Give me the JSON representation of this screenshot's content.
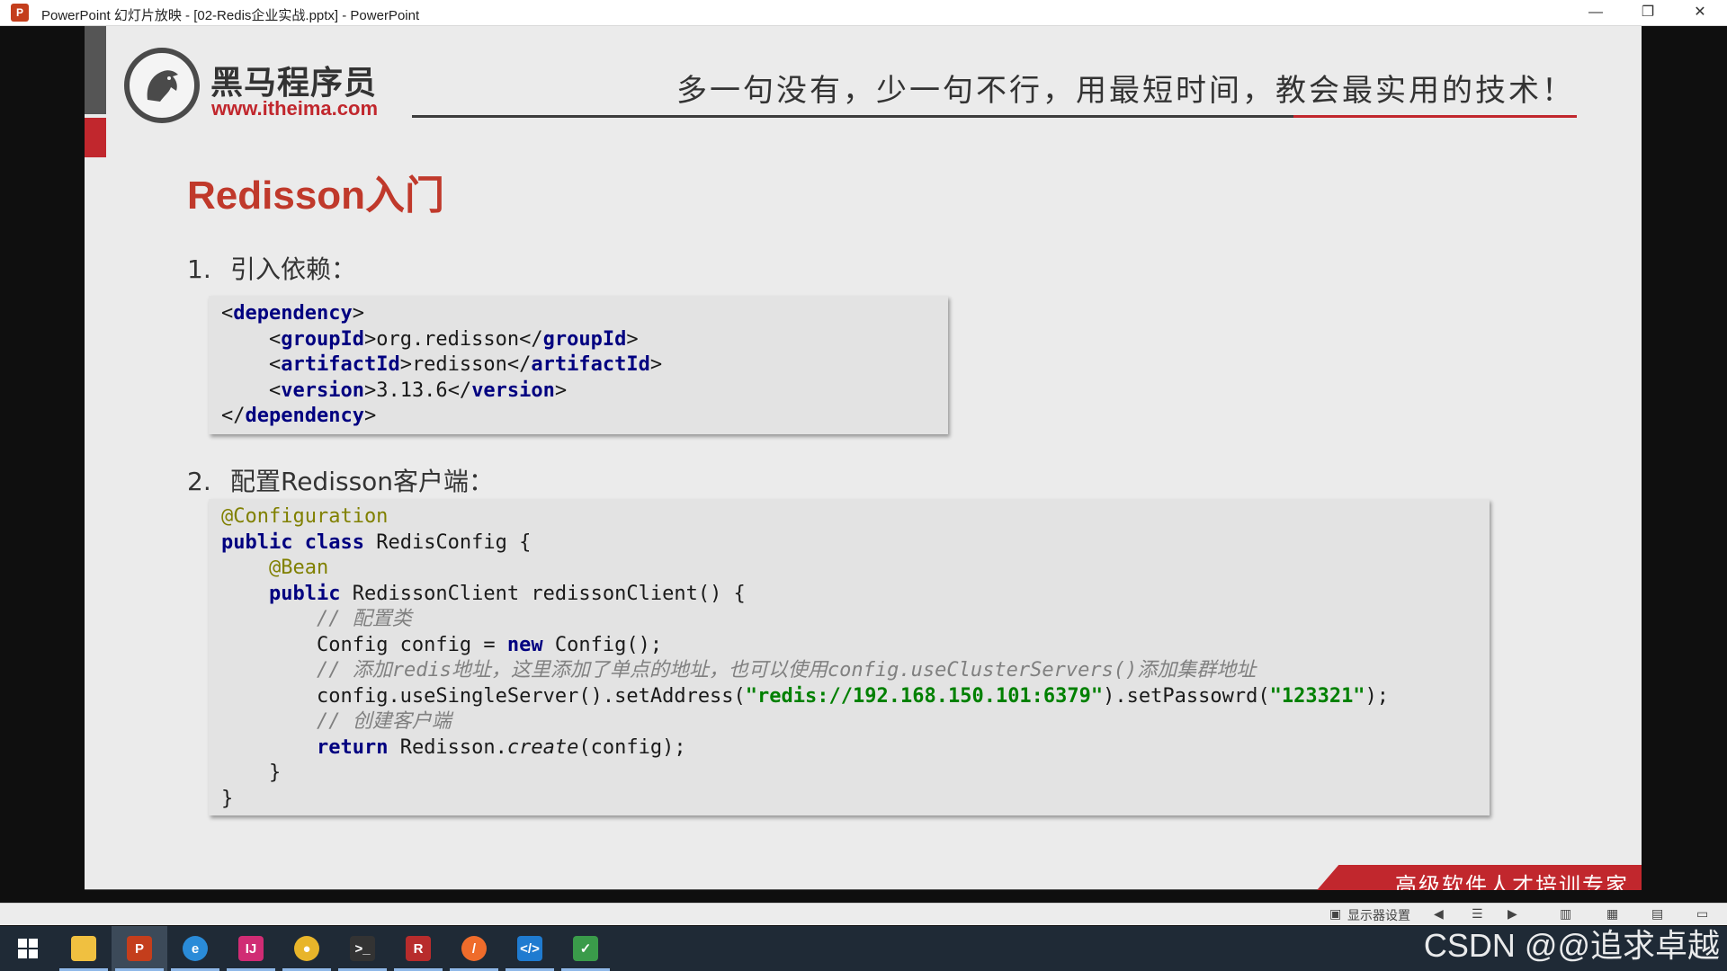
{
  "window": {
    "title": "PowerPoint 幻灯片放映 - [02-Redis企业实战.pptx] - PowerPoint",
    "minimize": "—",
    "restore": "❐",
    "close": "✕"
  },
  "slide": {
    "logo_cn": "黑马程序员",
    "logo_url": "www.itheima.com",
    "slogan": "多一句没有，少一句不行，用最短时间，教会最实用的技术！",
    "title": "Redisson入门",
    "step1": {
      "num": "1.",
      "label": "引入依赖："
    },
    "step2": {
      "num": "2.",
      "label": "配置Redisson客户端："
    },
    "footer": "高级软件人才培训专家",
    "dependency": {
      "tag": "dependency",
      "groupId_tag": "groupId",
      "groupId": "org.redisson",
      "artifactId_tag": "artifactId",
      "artifactId": "redisson",
      "version_tag": "version",
      "version": "3.13.6"
    },
    "code": {
      "ann_config": "@Configuration",
      "kw_public": "public",
      "kw_class": "class",
      "class_name": " RedisConfig {",
      "ann_bean": "@Bean",
      "method_sig": " RedissonClient redissonClient() {",
      "cmt1": "// 配置类",
      "config_decl": "Config config = ",
      "kw_new": "new",
      "config_ctor": " Config();",
      "cmt2": "// 添加redis地址，这里添加了单点的地址，也可以使用config.useClusterServers()添加集群地址",
      "use_single": "config.useSingleServer().setAddress(",
      "address": "\"redis://192.168.150.101:6379\"",
      "set_pwd": ").setPassowrd(",
      "password": "\"123321\"",
      "end_stmt": ");",
      "cmt3": "// 创建客户端",
      "kw_return": "return",
      "redisson_pre": " Redisson.",
      "create": "create",
      "create_args": "(config);",
      "close_method": "}",
      "close_class": "}"
    }
  },
  "controls": {
    "display_settings": "显示器设置"
  },
  "watermark": "CSDN @@追求卓越",
  "taskbar": {
    "items": [
      "start-icon",
      "file-explorer-icon",
      "powerpoint-icon",
      "browser-icon",
      "intellij-icon",
      "chrome-icon",
      "terminal-icon",
      "redis-icon",
      "postman-icon",
      "vscode-icon",
      "screenshot-icon"
    ]
  }
}
